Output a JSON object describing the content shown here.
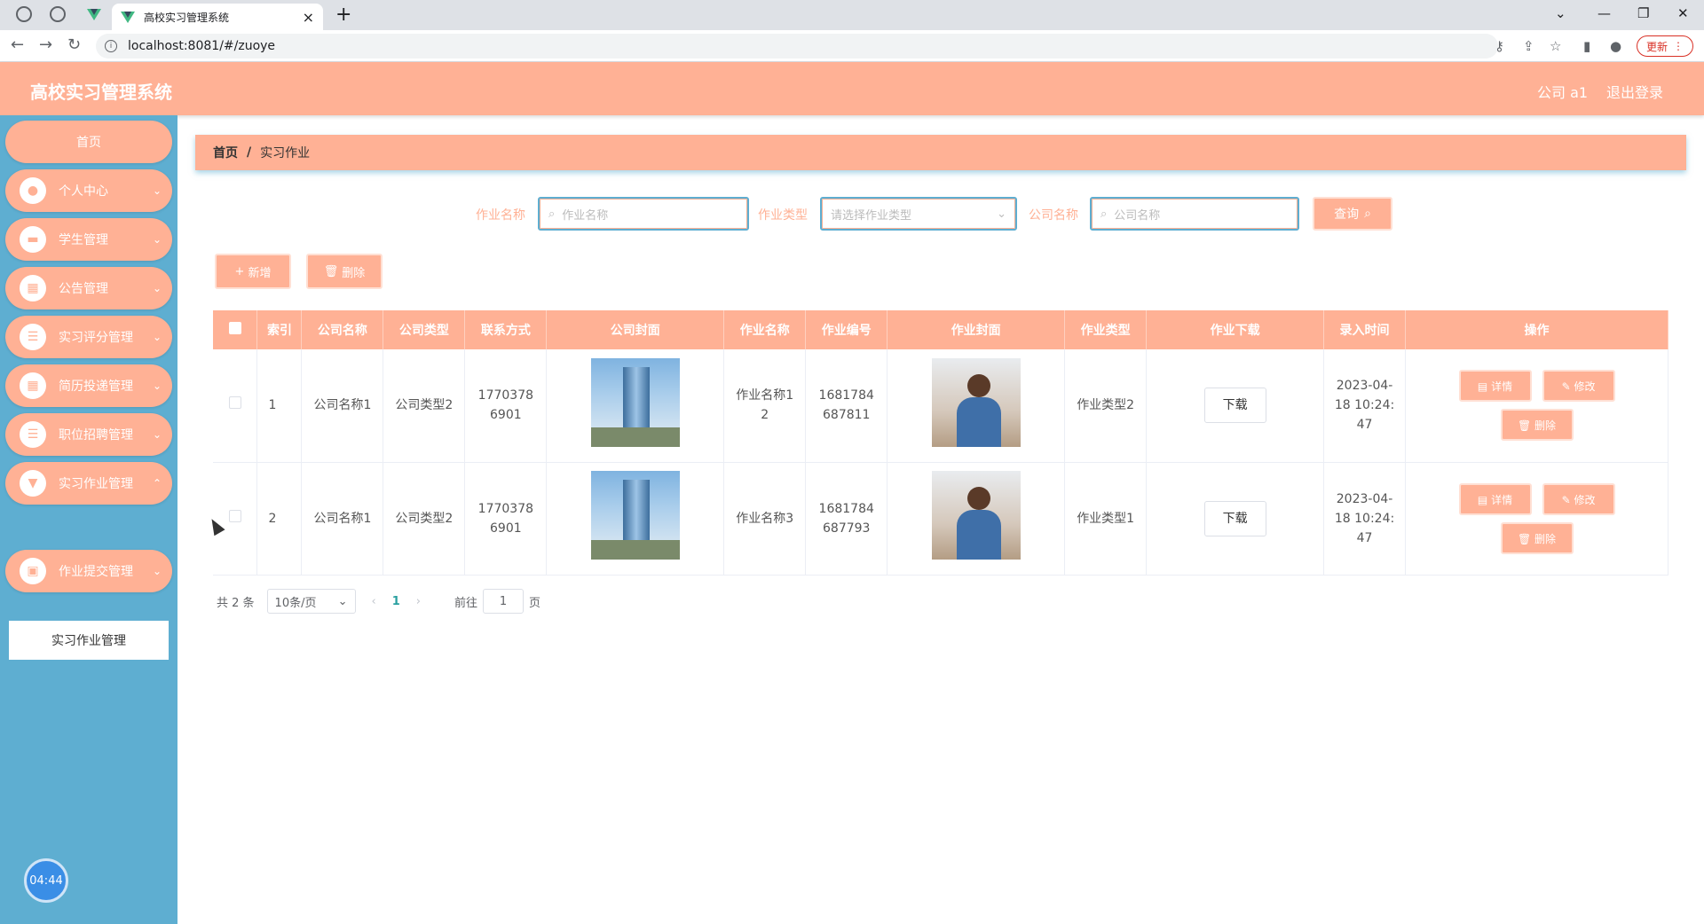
{
  "browser": {
    "tab_title": "高校实习管理系统",
    "url": "localhost:8081/#/zuoye",
    "update_label": "更新"
  },
  "header": {
    "title": "高校实习管理系统",
    "user": "公司 a1",
    "logout": "退出登录"
  },
  "sidebar": {
    "items": [
      {
        "label": "首页"
      },
      {
        "label": "个人中心"
      },
      {
        "label": "学生管理"
      },
      {
        "label": "公告管理"
      },
      {
        "label": "实习评分管理"
      },
      {
        "label": "简历投递管理"
      },
      {
        "label": "职位招聘管理"
      },
      {
        "label": "实习作业管理"
      },
      {
        "label": "作业提交管理"
      }
    ],
    "sub_item": "实习作业管理",
    "timer": "04:44"
  },
  "breadcrumb": {
    "home": "首页",
    "sep": "/",
    "current": "实习作业"
  },
  "search": {
    "name_label": "作业名称",
    "name_placeholder": "作业名称",
    "type_label": "作业类型",
    "type_placeholder": "请选择作业类型",
    "company_label": "公司名称",
    "company_placeholder": "公司名称",
    "query_label": "查询"
  },
  "actions": {
    "add_label": "新增",
    "delete_label": "删除"
  },
  "table": {
    "headers": [
      "索引",
      "公司名称",
      "公司类型",
      "联系方式",
      "公司封面",
      "作业名称",
      "作业编号",
      "作业封面",
      "作业类型",
      "作业下载",
      "录入时间",
      "操作"
    ],
    "rows": [
      {
        "index": "1",
        "company": "公司名称1",
        "ctype": "公司类型2",
        "contact": "17703786901",
        "hw_name": "作业名称12",
        "hw_no": "1681784687811",
        "hw_type": "作业类型2",
        "download": "下载",
        "time": "2023-04-18 10:24:47"
      },
      {
        "index": "2",
        "company": "公司名称1",
        "ctype": "公司类型2",
        "contact": "17703786901",
        "hw_name": "作业名称3",
        "hw_no": "1681784687793",
        "hw_type": "作业类型1",
        "download": "下载",
        "time": "2023-04-18 10:24:47"
      }
    ],
    "op_detail": "详情",
    "op_edit": "修改",
    "op_delete": "删除"
  },
  "pager": {
    "total": "共 2 条",
    "page_size": "10条/页",
    "current": "1",
    "goto_prefix": "前往",
    "goto_value": "1",
    "goto_suffix": "页"
  },
  "colors": {
    "accent": "#ffb195",
    "sidebar": "#5eaed1"
  }
}
